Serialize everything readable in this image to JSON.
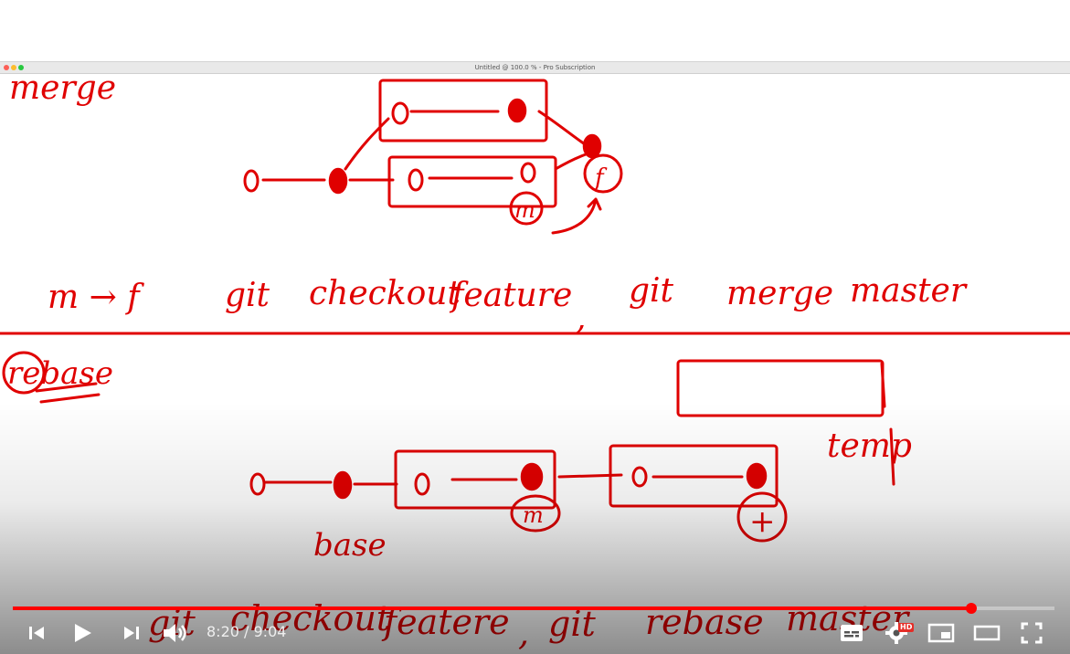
{
  "window": {
    "title": "Untitled @ 100.0 % - Pro Subscription"
  },
  "whiteboard": {
    "merge": {
      "label": "merge",
      "command": {
        "arrow": "m → f",
        "git1": "git",
        "checkout": "checkout",
        "feature": "feature",
        "git2": "git",
        "merge": "merge",
        "master": "master"
      },
      "nodes": {
        "plain": "o",
        "f": "f",
        "m": "m"
      }
    },
    "rebase": {
      "label": "rebase",
      "base_label": "base",
      "temp_label": "temp",
      "command": {
        "git1": "git",
        "checkout": "checkout",
        "feature": "featere",
        "git2": "git",
        "rebase": "rebase",
        "master": "master"
      },
      "nodes": {
        "plain": "o",
        "m": "m"
      }
    }
  },
  "player": {
    "current_time": "8:20",
    "duration": "9:04",
    "time_text": "8:20 / 9:04",
    "progress": 0.92,
    "hd_badge": "HD",
    "accent": "#ff0000",
    "icons": [
      "previous-icon",
      "play-icon",
      "next-icon",
      "volume-icon",
      "subtitles-icon",
      "settings-icon",
      "miniplayer-icon",
      "theater-icon",
      "fullscreen-icon"
    ]
  }
}
